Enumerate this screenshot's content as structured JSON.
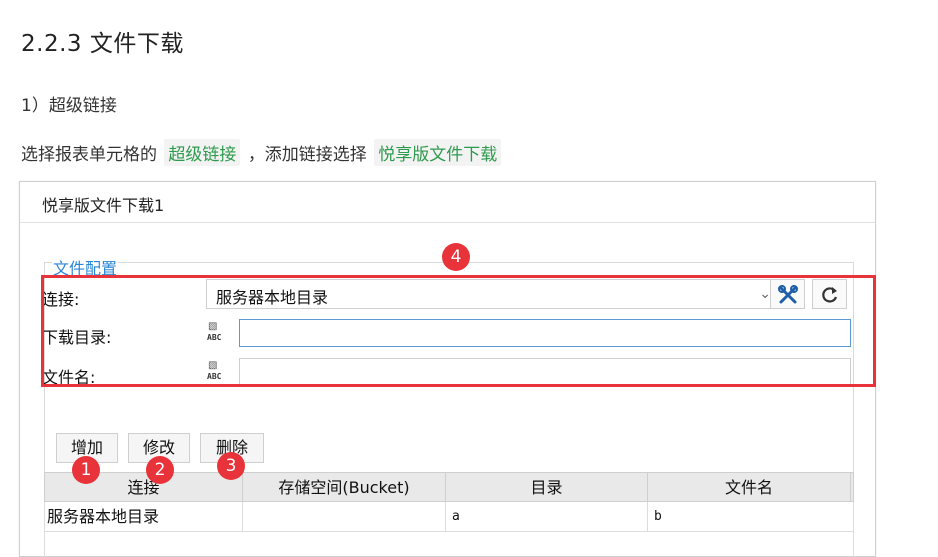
{
  "doc": {
    "heading": "2.2.3 文件下载",
    "subheading": "1）超级链接",
    "para_before": "选择报表单元格的",
    "code1": "超级链接",
    "para_middle": "，添加链接选择",
    "code2": "悦享版文件下载"
  },
  "dialog": {
    "title": "悦享版文件下载1",
    "group_title": "文件配置",
    "connection_label": "连接:",
    "connection_value": "服务器本地目录",
    "download_dir_label": "下载目录:",
    "download_dir_value": "",
    "filename_label": "文件名:",
    "filename_value": "",
    "abc_text": "ABC"
  },
  "buttons": {
    "add": "增加",
    "edit": "修改",
    "delete": "删除"
  },
  "badges": {
    "b1": "1",
    "b2": "2",
    "b3": "3",
    "b4": "4"
  },
  "table": {
    "columns": [
      "连接",
      "存储空间(Bucket)",
      "目录",
      "文件名"
    ],
    "rows": [
      [
        "服务器本地目录",
        "",
        "a",
        "b"
      ]
    ]
  },
  "colors": {
    "highlight_red": "#e8333a",
    "code_green": "#2e9a4d",
    "link_blue": "#2a86d6",
    "focus_blue": "#5b9bd5"
  }
}
